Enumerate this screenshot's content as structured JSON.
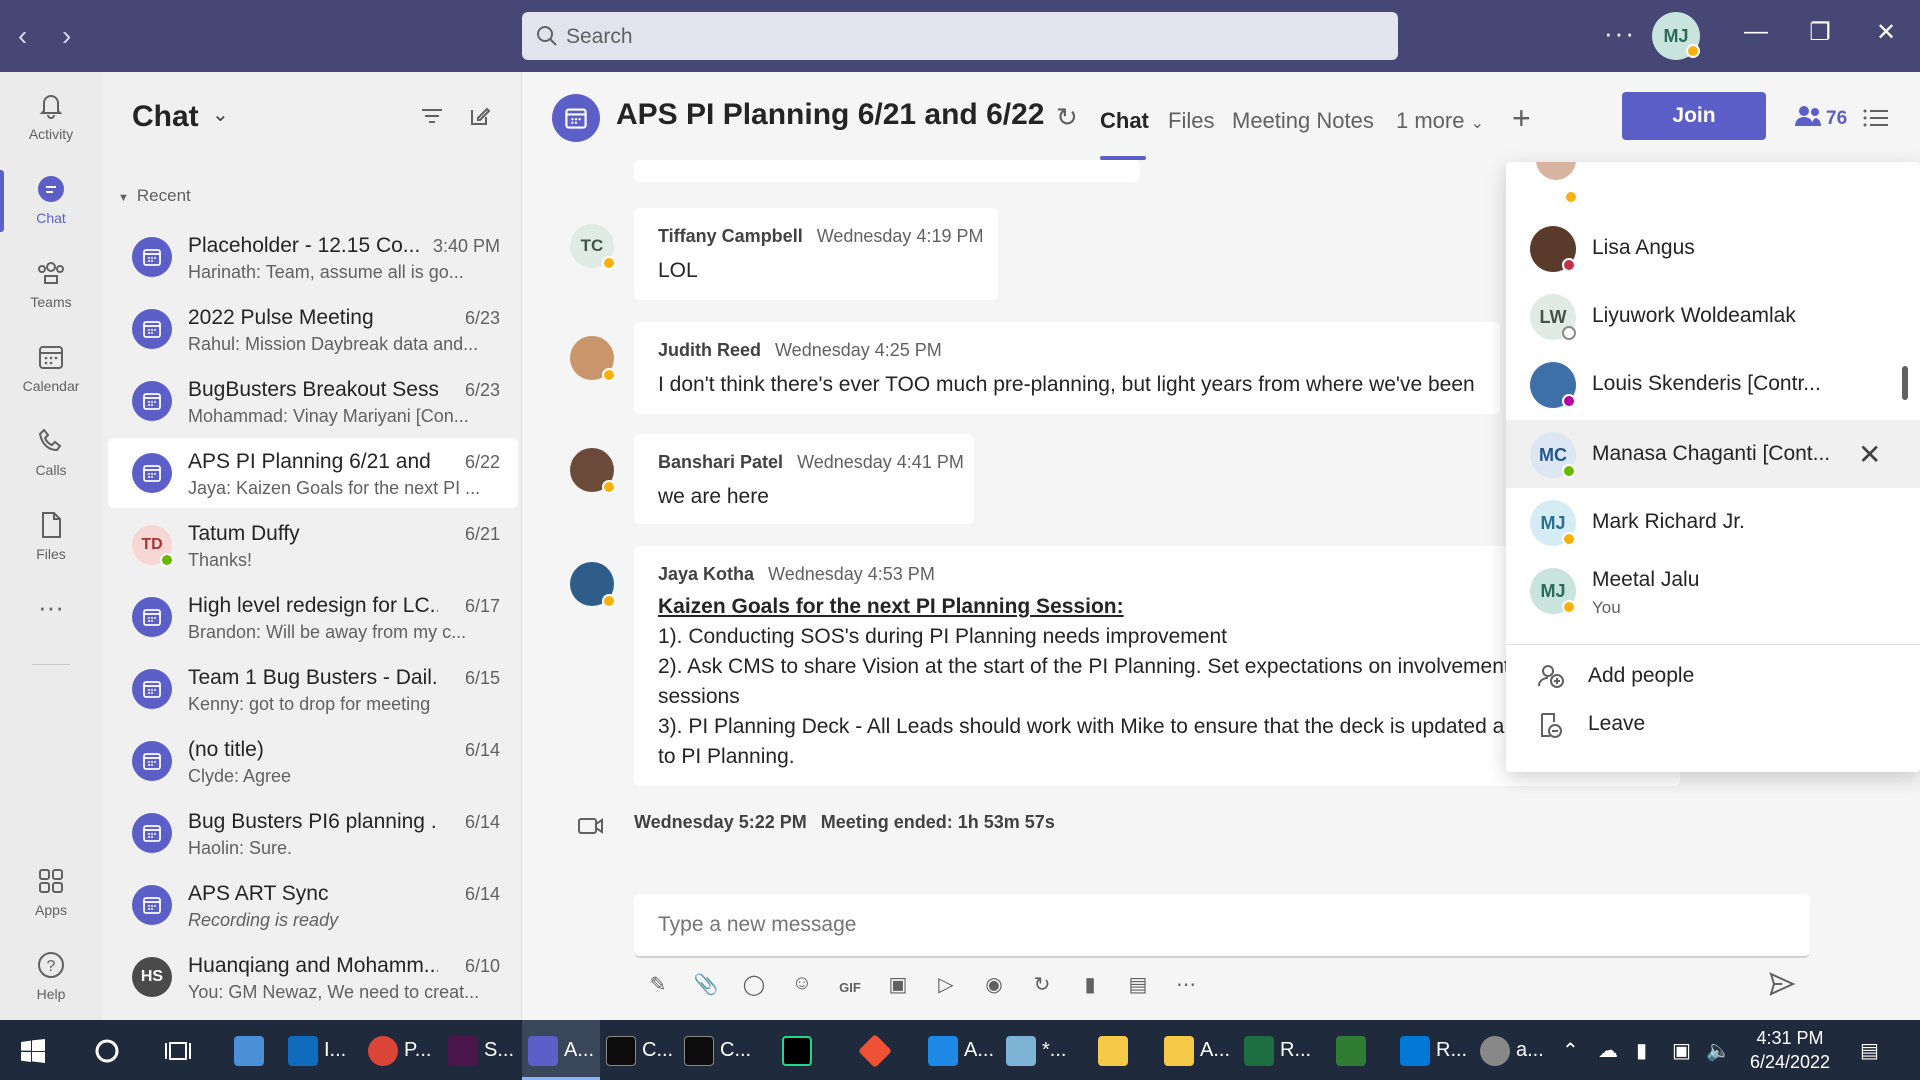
{
  "topbar": {
    "search_placeholder": "Search",
    "more": "···",
    "me_initials": "MJ"
  },
  "rail": [
    {
      "label": "Activity",
      "icon": "bell-icon"
    },
    {
      "label": "Chat",
      "icon": "chat-icon"
    },
    {
      "label": "Teams",
      "icon": "teams-icon"
    },
    {
      "label": "Calendar",
      "icon": "calendar-icon"
    },
    {
      "label": "Calls",
      "icon": "phone-icon"
    },
    {
      "label": "Files",
      "icon": "file-icon"
    },
    {
      "label": "···",
      "icon": "more-icon"
    },
    {
      "label": "Apps",
      "icon": "apps-icon"
    },
    {
      "label": "Help",
      "icon": "help-icon"
    }
  ],
  "chatlist": {
    "title": "Chat",
    "section": "Recent",
    "items": [
      {
        "name": "Placeholder - 12.15 Co...",
        "time": "3:40 PM",
        "preview": "Harinath: Team, assume all is go..."
      },
      {
        "name": "2022 Pulse Meeting",
        "time": "6/23",
        "preview": "Rahul: Mission Daybreak data and..."
      },
      {
        "name": "BugBusters Breakout Sessi...",
        "time": "6/23",
        "preview": "Mohammad: Vinay Mariyani [Con..."
      },
      {
        "name": "APS PI Planning 6/21 and ...",
        "time": "6/22",
        "preview": "Jaya: Kaizen Goals for the next PI ..."
      },
      {
        "name": "Tatum Duffy",
        "time": "6/21",
        "preview": "Thanks!",
        "initials": "TD"
      },
      {
        "name": "High level redesign for LC...",
        "time": "6/17",
        "preview": "Brandon: Will be away from my c..."
      },
      {
        "name": "Team 1 Bug Busters - Dail...",
        "time": "6/15",
        "preview": "Kenny: got to drop for meeting"
      },
      {
        "name": "(no title)",
        "time": "6/14",
        "preview": "Clyde: Agree"
      },
      {
        "name": "Bug Busters PI6 planning ...",
        "time": "6/14",
        "preview": "Haolin: Sure."
      },
      {
        "name": "APS ART Sync",
        "time": "6/14",
        "preview": "Recording is ready"
      },
      {
        "name": "Huanqiang and Mohamm...",
        "time": "6/10",
        "preview": "You: GM Newaz, We need to creat...",
        "initials": "HS"
      }
    ]
  },
  "header": {
    "title": "APS PI Planning 6/21 and 6/22",
    "tabs": [
      "Chat",
      "Files",
      "Meeting Notes",
      "1 more"
    ],
    "join": "Join",
    "participant_count": "76"
  },
  "messages": [
    {
      "initials": "TC",
      "author": "Tiffany Campbell",
      "time": "Wednesday 4:19 PM",
      "lines": [
        "LOL"
      ]
    },
    {
      "author": "Judith Reed",
      "time": "Wednesday 4:25 PM",
      "lines": [
        "I don't think there's ever TOO much pre-planning, but light years from where we've been"
      ]
    },
    {
      "author": "Banshari Patel",
      "time": "Wednesday 4:41 PM",
      "lines": [
        "we are here"
      ]
    },
    {
      "author": "Jaya Kotha",
      "time": "Wednesday 4:53 PM",
      "heading": "Kaizen Goals for the next PI Planning Session:",
      "lines": [
        "1). Conducting SOS's during PI Planning needs improvement",
        "2). Ask CMS to share Vision at the start of the PI Planning. Set expectations on involvement i",
        "sessions",
        "3). PI Planning Deck - All Leads should work with Mike to ensure that the deck is updated a",
        "to PI Planning."
      ]
    }
  ],
  "meeting_event": {
    "time": "Wednesday 5:22 PM",
    "label": "Meeting ended:",
    "duration": "1h 53m 57s"
  },
  "compose": {
    "placeholder": "Type a new message"
  },
  "participants_panel": {
    "people": [
      {
        "name": "Lisa Angus",
        "status": "busy"
      },
      {
        "name": "Liyuwork Woldeamlak",
        "initials": "LW",
        "status": "offline"
      },
      {
        "name": "Louis Skenderis [Contr...",
        "status": "oof"
      },
      {
        "name": "Manasa Chaganti [Cont...",
        "initials": "MC",
        "status": "available"
      },
      {
        "name": "Mark Richard Jr.",
        "initials": "MJ",
        "status": "away"
      },
      {
        "name": "Meetal Jalu",
        "initials": "MJ",
        "sub": "You",
        "status": "away"
      }
    ],
    "actions": [
      "Add people",
      "Leave"
    ]
  },
  "taskbar": {
    "apps": [
      {
        "label": "I...",
        "color": "#0f6cbd"
      },
      {
        "label": "P...",
        "color": "#db4437"
      },
      {
        "label": "S...",
        "color": "#4a154b"
      },
      {
        "label": "A...",
        "color": "#5b5fc7"
      },
      {
        "label": "C...",
        "color": "#0c0c0c"
      },
      {
        "label": "C...",
        "color": "#0c0c0c"
      },
      {
        "label": "",
        "color": "#21d789"
      },
      {
        "label": "",
        "color": "#f05033"
      },
      {
        "label": "A...",
        "color": "#1e88e5"
      },
      {
        "label": "*...",
        "color": "#7fb3d5"
      },
      {
        "label": "",
        "color": "#f7c948"
      },
      {
        "label": "A...",
        "color": "#f7c948"
      },
      {
        "label": "R...",
        "color": "#1d6f42"
      },
      {
        "label": "",
        "color": "#2e7d32"
      },
      {
        "label": "R...",
        "color": "#0078d4"
      },
      {
        "label": "a...",
        "color": "#888888"
      }
    ],
    "time": "4:31 PM",
    "date": "6/24/2022"
  }
}
